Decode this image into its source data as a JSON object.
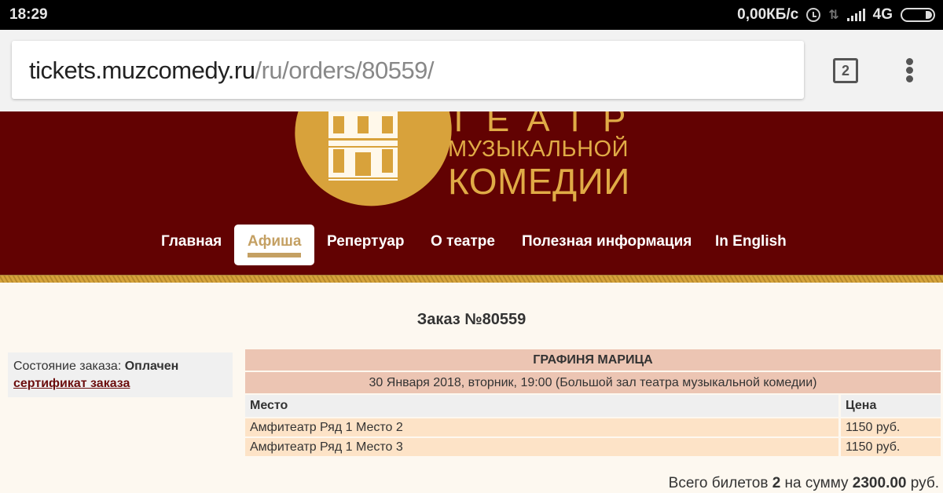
{
  "status_bar": {
    "time": "18:29",
    "network_speed": "0,00КБ/с",
    "network_type": "4G",
    "icons": [
      "alarm-icon",
      "data-arrows-icon",
      "signal-icon",
      "battery-icon"
    ]
  },
  "browser": {
    "url_host": "tickets.muzcomedy.ru",
    "url_path": "/ru/orders/80559/",
    "tab_count": "2",
    "menu_icon": "more-vertical-icon"
  },
  "header": {
    "logo_line1": "ТЕАТР",
    "logo_line2": "МУЗЫКАЛЬНОЙ",
    "logo_line3": "КОМЕДИИ",
    "nav": [
      {
        "label": "Главная",
        "active": false
      },
      {
        "label": "Афиша",
        "active": true
      },
      {
        "label": "Репертуар",
        "active": false
      },
      {
        "label": "О театре",
        "active": false
      },
      {
        "label": "Полезная информация",
        "active": false
      },
      {
        "label": "In English",
        "active": false
      }
    ]
  },
  "order": {
    "title": "Заказ №80559",
    "status_label": "Состояние заказа:",
    "status_value": "Оплачен",
    "certificate_link": "сертификат заказа",
    "show_title": "ГРАФИНЯ МАРИЦА",
    "show_datetime": "30 Января 2018, вторник, 19:00 (Большой зал театра музыкальной комедии)",
    "columns": [
      "Место",
      "Цена"
    ],
    "seats": [
      {
        "place": "Амфитеатр Ряд 1 Место 2",
        "price": "1150 руб."
      },
      {
        "place": "Амфитеатр Ряд 1 Место 3",
        "price": "1150 руб."
      }
    ],
    "total_prefix": "Всего билетов",
    "total_count": "2",
    "total_middle": "на сумму",
    "total_sum": "2300.00",
    "total_currency": "руб."
  },
  "colors": {
    "header_bg": "#620202",
    "gold": "#e0ab46",
    "active_nav_text": "#c4a063",
    "link": "#6b0d0d",
    "table_title_bg": "#ecc5b3",
    "seat_row_bg": "#fde3c7"
  }
}
